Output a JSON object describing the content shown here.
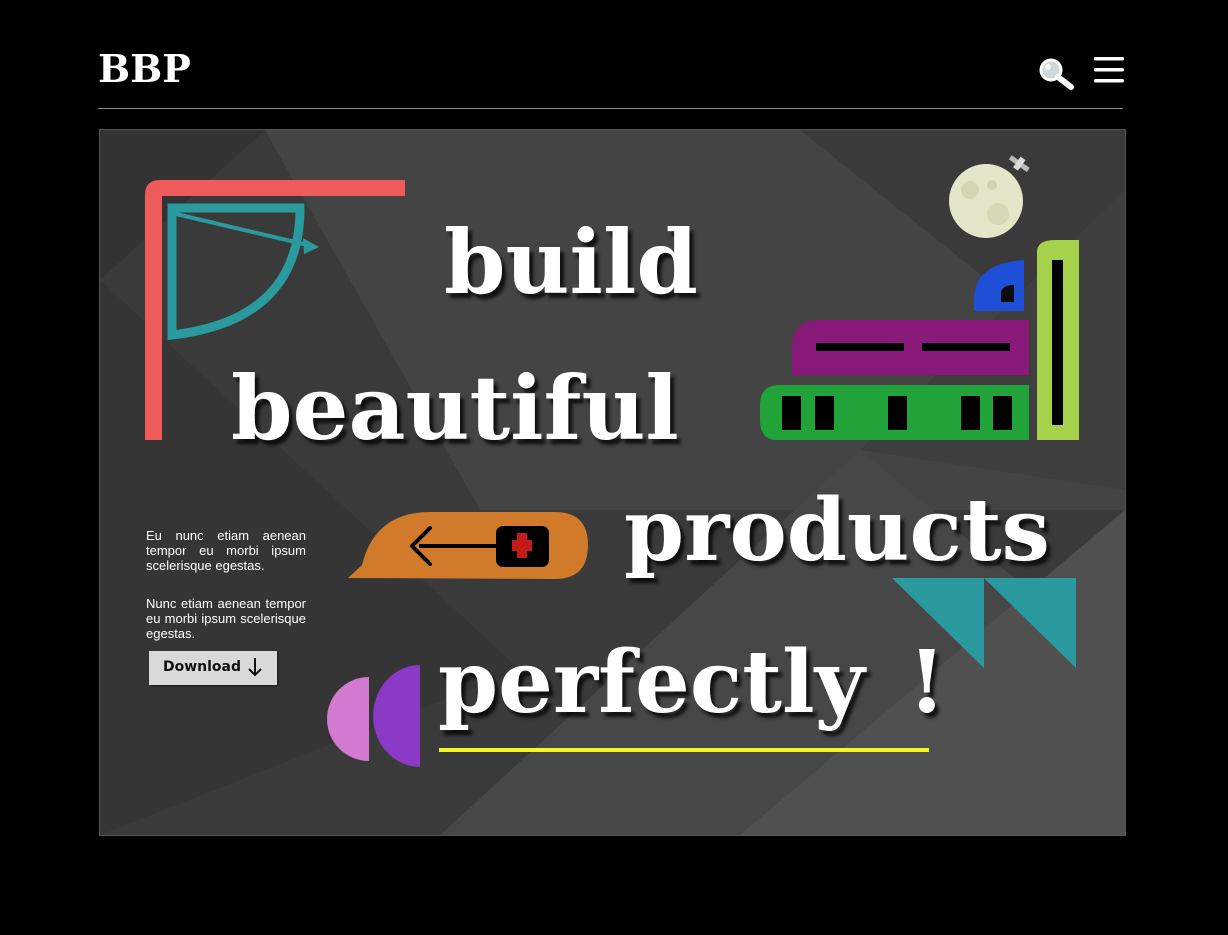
{
  "header": {
    "logo": "BBP",
    "search_icon": "search-icon",
    "menu_icon": "hamburger-menu-icon"
  },
  "hero": {
    "words": {
      "build": "build",
      "beautiful": "beautiful",
      "products": "products",
      "perfectly": "perfectly",
      "exclamation": "!"
    },
    "paragraph1": "Eu nunc etiam aenean tempor eu morbi ipsum scelerisque egestas.",
    "paragraph2": "Nunc etiam aenean tempor eu morbi ipsum scelerisque egestas.",
    "download_label": "Download",
    "download_icon": "arrow-down-icon"
  },
  "colors": {
    "background": "#000000",
    "hero_background": "#3a3a3a",
    "coral": "#ef5b5b",
    "teal": "#2a9a9e",
    "orange": "#d07a2a",
    "purple": "#8a1a7a",
    "green": "#22a33a",
    "lime": "#a6d14a",
    "blue": "#1f4fd6",
    "yellow": "#f5f52a"
  }
}
